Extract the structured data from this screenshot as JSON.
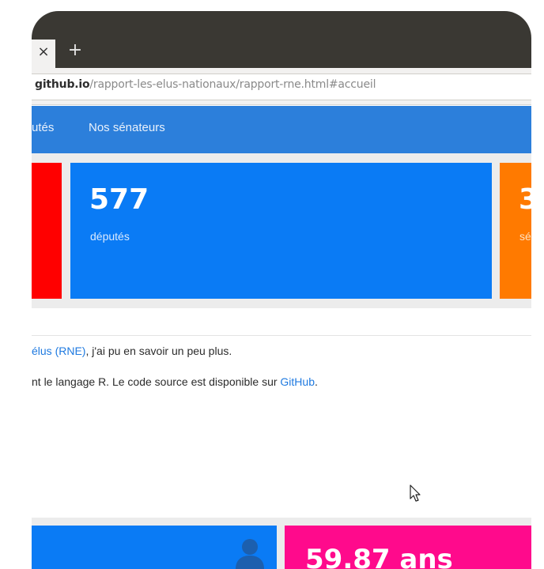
{
  "browser": {
    "tab_close_glyph": "×",
    "new_tab_glyph": "+",
    "url_host": "github.io",
    "url_path": "/rapport-les-elus-nationaux/rapport-rne.html#accueil"
  },
  "nav": {
    "deputes_label": "utés",
    "senateurs_label": "Nos sénateurs",
    "color": "#2c7fdb"
  },
  "stats": {
    "deputes_number": "577",
    "deputes_label": "députés",
    "senateurs_number": "3",
    "senateurs_label": "sé",
    "colors": {
      "red": "#ff0000",
      "blue": "#0a7bf5",
      "orange": "#ff7a00"
    }
  },
  "content": {
    "para1_link": "élus (RNE)",
    "para1_rest": ", j'ai pu en savoir un peu plus.",
    "para2_text": "nt le langage R. Le code source est disponible sur ",
    "para2_link": "GitHub",
    "para2_end": "."
  },
  "cards": {
    "age_value": "59.87 ans",
    "person_icon": "person-icon",
    "colors": {
      "blue": "#0a7bf5",
      "pink": "#ff0a8c"
    }
  }
}
